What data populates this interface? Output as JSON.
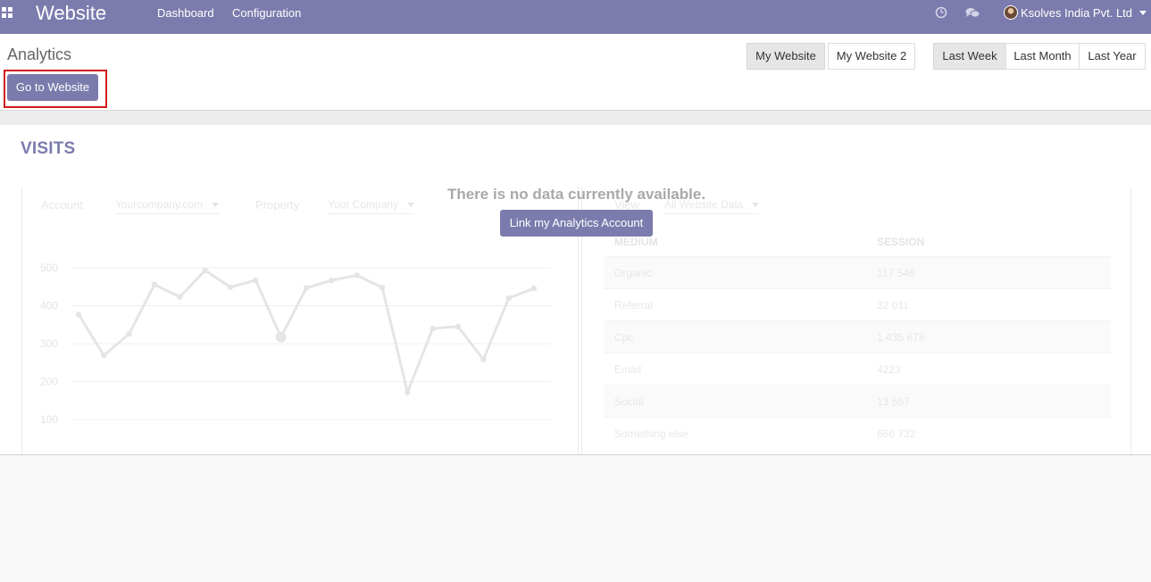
{
  "navbar": {
    "app_title": "Website",
    "menu": [
      "Dashboard",
      "Configuration"
    ],
    "user_name": "Ksolves India Pvt. Ltd",
    "icons": [
      "apps-grid-icon",
      "clock-icon",
      "chat-icon",
      "avatar",
      "caret-down-icon"
    ]
  },
  "control_panel": {
    "breadcrumb": "Analytics",
    "go_to_website": "Go to Website",
    "websites": [
      {
        "label": "My Website",
        "active": true
      },
      {
        "label": "My Website 2",
        "active": false
      }
    ],
    "periods": [
      {
        "label": "Last Week",
        "active": true
      },
      {
        "label": "Last Month",
        "active": false
      },
      {
        "label": "Last Year",
        "active": false
      }
    ]
  },
  "main": {
    "section_title": "VISITS",
    "empty_message": "There is no data currently available.",
    "link_button": "Link my Analytics Account"
  },
  "placeholder": {
    "account_label": "Account",
    "account_value": "Yourcompany.com",
    "property_label": "Property",
    "property_value": "Your Company",
    "view_label": "View",
    "view_value": "All Website Data",
    "table": {
      "columns": [
        "MEDIUM",
        "SESSION"
      ],
      "rows": [
        [
          "Organic",
          "117 546"
        ],
        [
          "Referral",
          "32 011"
        ],
        [
          "Cpc",
          "1 435 678"
        ],
        [
          "Email",
          "4223"
        ],
        [
          "Social",
          "13 567"
        ],
        [
          "Something else",
          "666 732"
        ]
      ]
    }
  },
  "chart_data": {
    "type": "line",
    "y_ticks": [
      "500",
      "400",
      "300",
      "200",
      "100"
    ],
    "ylim": [
      100,
      500
    ],
    "values": [
      377,
      269,
      326,
      456,
      423,
      493,
      449,
      467,
      317,
      447,
      467,
      480,
      448,
      172,
      340,
      345,
      258,
      420,
      446
    ]
  },
  "colors": {
    "navbar": "#7c7bad",
    "accent": "#7c7bad",
    "highlight_box": "#d21a1a"
  }
}
